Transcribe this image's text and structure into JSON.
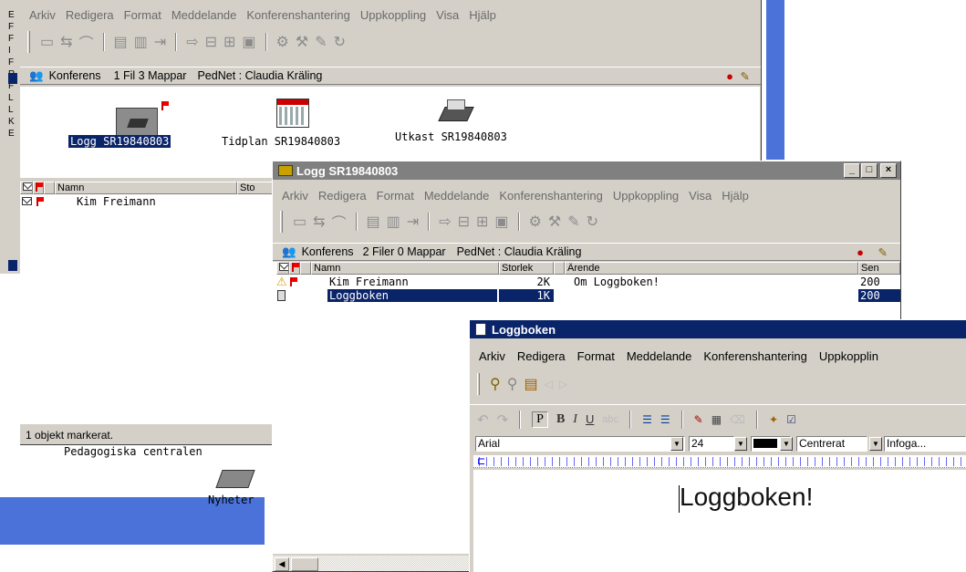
{
  "left_edge": {
    "letters": [
      "E",
      "F",
      "F",
      "I",
      "F",
      "R",
      "F",
      "L",
      "L",
      "K",
      "E"
    ]
  },
  "win1": {
    "menu": [
      "Arkiv",
      "Redigera",
      "Format",
      "Meddelande",
      "Konferenshantering",
      "Uppkoppling",
      "Visa",
      "Hjälp"
    ],
    "conf": {
      "label": "Konferens",
      "counts": "1 Fil 3 Mappar",
      "user": "PedNet : Claudia Kräling"
    },
    "icons": [
      {
        "label": "Logg SR19840803",
        "icon": "folder-icon"
      },
      {
        "label": "Tidplan SR19840803",
        "icon": "calendar-icon"
      },
      {
        "label": "Utkast SR19840803",
        "icon": "tray-icon"
      }
    ],
    "columns": {
      "name": "Namn",
      "size": "Sto"
    },
    "rows": [
      {
        "name": "Kim Freimann"
      }
    ],
    "status": "1 objekt markerat."
  },
  "bg": {
    "center_label": "Pedagogiska centralen",
    "news_label": "Nyheter"
  },
  "win2": {
    "title": "Logg SR19840803",
    "menu": [
      "Arkiv",
      "Redigera",
      "Format",
      "Meddelande",
      "Konferenshantering",
      "Uppkoppling",
      "Visa",
      "Hjälp"
    ],
    "conf": {
      "label": "Konferens",
      "counts": "2 Filer 0 Mappar",
      "user": "PedNet : Claudia Kräling"
    },
    "columns": {
      "name": "Namn",
      "size": "Storlek",
      "subject": "Ärende",
      "sent": "Sen"
    },
    "rows": [
      {
        "name": "Kim Freimann",
        "size": "2K",
        "subject": "Om Loggboken!",
        "sent": "200"
      },
      {
        "name": "Loggboken",
        "size": "1K",
        "subject": "",
        "sent": "200"
      }
    ]
  },
  "win3": {
    "title": "Loggboken",
    "menu": [
      "Arkiv",
      "Redigera",
      "Format",
      "Meddelande",
      "Konferenshantering",
      "Uppkopplin"
    ],
    "font": "Arial",
    "size": "24",
    "align": "Centrerat",
    "insert": "Infoga...",
    "format_buttons": {
      "p": "P",
      "b": "B",
      "i": "I",
      "u": "U"
    },
    "body_text": "Loggboken!"
  },
  "colors": {
    "selection": "#0a246a",
    "titlebar_active": "#0a246a",
    "titlebar_inactive": "#808080",
    "desktop_blue": "#4a72d8"
  }
}
